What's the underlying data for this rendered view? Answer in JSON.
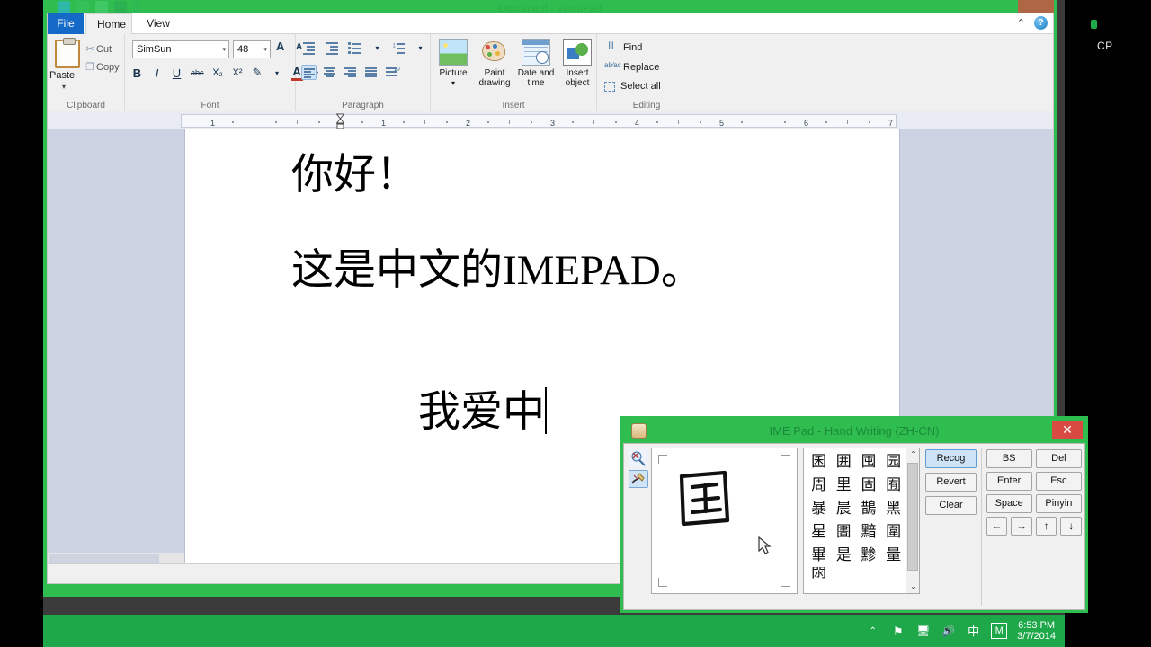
{
  "window": {
    "title": "Document - WordPad",
    "close_label": "✕"
  },
  "tabs": {
    "file": "File",
    "home": "Home",
    "view": "View",
    "collapse_icon": "⌃",
    "help_icon": "?"
  },
  "ribbon": {
    "groups": {
      "clipboard": "Clipboard",
      "font": "Font",
      "paragraph": "Paragraph",
      "insert": "Insert",
      "editing": "Editing"
    },
    "clipboard": {
      "paste": "Paste",
      "paste_arrow": "▾",
      "cut": "Cut",
      "copy": "Copy",
      "cut_icon": "✂",
      "copy_icon": "❐"
    },
    "font": {
      "family_value": "SimSun",
      "size_value": "48",
      "combo_arrow": "▾",
      "grow": "A",
      "shrink": "A",
      "bold": "B",
      "italic": "I",
      "underline": "U",
      "strikethrough": "abc",
      "subscript": "X₂",
      "superscript": "X²",
      "highlight_icon": "✎",
      "fontcolor_icon": "A",
      "dropdown_arrow": "▾"
    },
    "insert": [
      {
        "label": "Picture",
        "icon": "picture-icon",
        "arrow": "▾"
      },
      {
        "label": "Paint\ndrawing",
        "icon": "paint-icon"
      },
      {
        "label": "Date and\ntime",
        "icon": "calendar-clock-icon"
      },
      {
        "label": "Insert\nobject",
        "icon": "object-icon"
      }
    ],
    "editing": [
      {
        "label": "Find",
        "icon": "binoculars-icon"
      },
      {
        "label": "Replace",
        "icon": "replace-icon"
      },
      {
        "label": "Select all",
        "icon": "select-all-icon"
      }
    ]
  },
  "ruler": {
    "ticks": [
      "1",
      "1",
      "2",
      "3",
      "4",
      "5",
      "6",
      "7"
    ]
  },
  "document": {
    "line1": "你好！",
    "line2": "这是中文的IMEPAD。",
    "line3": "我爱中"
  },
  "imepad": {
    "title": "IME Pad - Hand Writing (ZH-CN)",
    "close_label": "✕",
    "tools": [
      {
        "name": "radical-search-icon",
        "selected": false
      },
      {
        "name": "hand-writing-icon",
        "selected": true
      }
    ],
    "canvas": {
      "drawn_character": "国"
    },
    "candidates": [
      "囷",
      "囲",
      "囤",
      "园",
      "周",
      "里",
      "固",
      "囿",
      "暴",
      "晨",
      "鵲",
      "黑",
      "星",
      "圕",
      "黯",
      "圍",
      "畢",
      "是",
      "黪",
      "量",
      "閖",
      "",
      "",
      ""
    ],
    "scroll": {
      "up": "⌃",
      "down": "⌄"
    },
    "recog_buttons": [
      {
        "label": "Recog",
        "highlighted": true
      },
      {
        "label": "Revert",
        "highlighted": false
      },
      {
        "label": "Clear",
        "highlighted": false
      }
    ],
    "keypad": [
      [
        "BS",
        "Del"
      ],
      [
        "Enter",
        "Esc"
      ],
      [
        "Space",
        "Pinyin"
      ],
      [
        "←",
        "→",
        "↑",
        "↓"
      ]
    ]
  },
  "desktop": {
    "label": "CP"
  },
  "taskbar": {
    "tray": [
      {
        "name": "show-hidden-icons",
        "glyph": "⌃"
      },
      {
        "name": "action-center-flag-icon",
        "glyph": "⚑"
      },
      {
        "name": "network-icon",
        "glyph": "🖥"
      },
      {
        "name": "volume-icon",
        "glyph": "🔊"
      },
      {
        "name": "ime-language-icon",
        "glyph": "中"
      }
    ],
    "ime_mode_badge": "M",
    "time": "6:53 PM",
    "date": "3/7/2014"
  }
}
